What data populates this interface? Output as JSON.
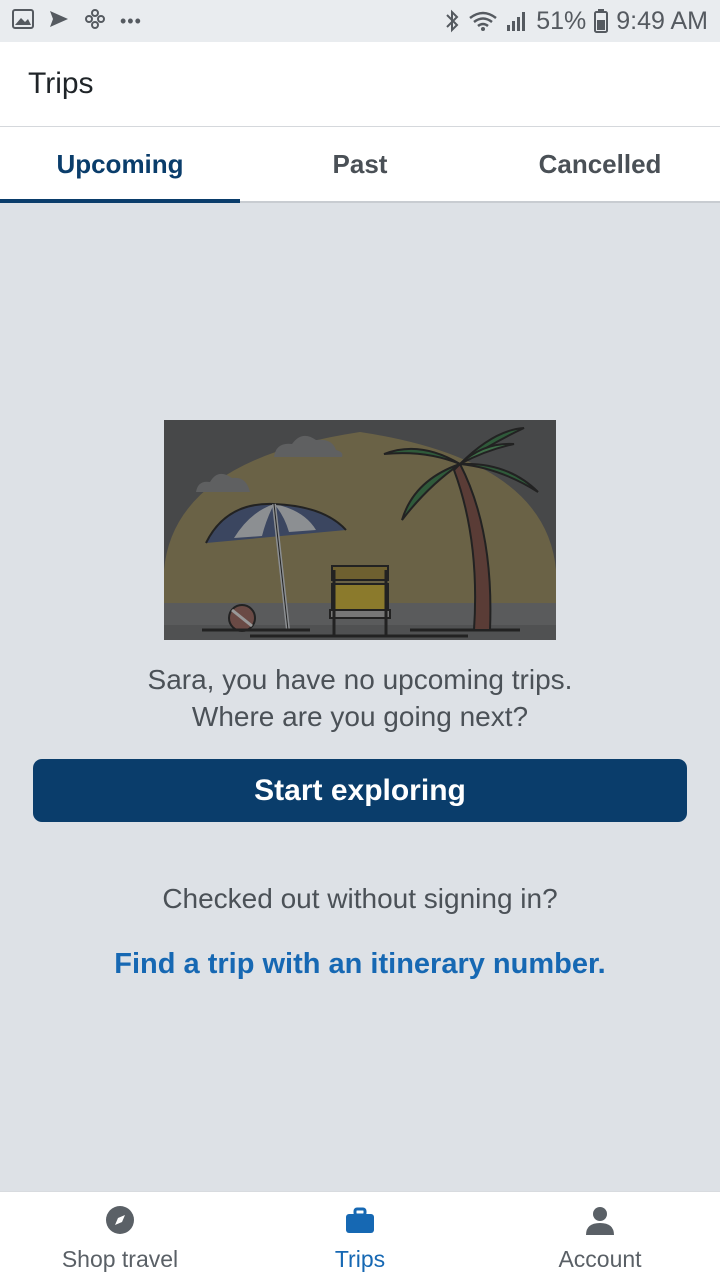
{
  "status": {
    "battery": "51%",
    "time": "9:49 AM",
    "overflow": "•••",
    "icons": [
      "gallery-icon",
      "send-icon",
      "flower-icon",
      "bluetooth-icon",
      "wifi-icon",
      "signal-icon",
      "battery-icon"
    ]
  },
  "header": {
    "title": "Trips"
  },
  "tabs": [
    {
      "label": "Upcoming",
      "active": true
    },
    {
      "label": "Past",
      "active": false
    },
    {
      "label": "Cancelled",
      "active": false
    }
  ],
  "empty_state": {
    "line1": "Sara, you have no upcoming trips.",
    "line2": "Where are you going next?",
    "cta_label": "Start exploring",
    "signin_question": "Checked out without signing in?",
    "find_link": "Find a trip with an itinerary number."
  },
  "bottom_nav": [
    {
      "label": "Shop travel",
      "icon": "compass-icon",
      "active": false
    },
    {
      "label": "Trips",
      "icon": "briefcase-icon",
      "active": true
    },
    {
      "label": "Account",
      "icon": "person-icon",
      "active": false
    }
  ],
  "colors": {
    "primary": "#0a3d6b",
    "link": "#1668b3",
    "background": "#dde1e6"
  }
}
